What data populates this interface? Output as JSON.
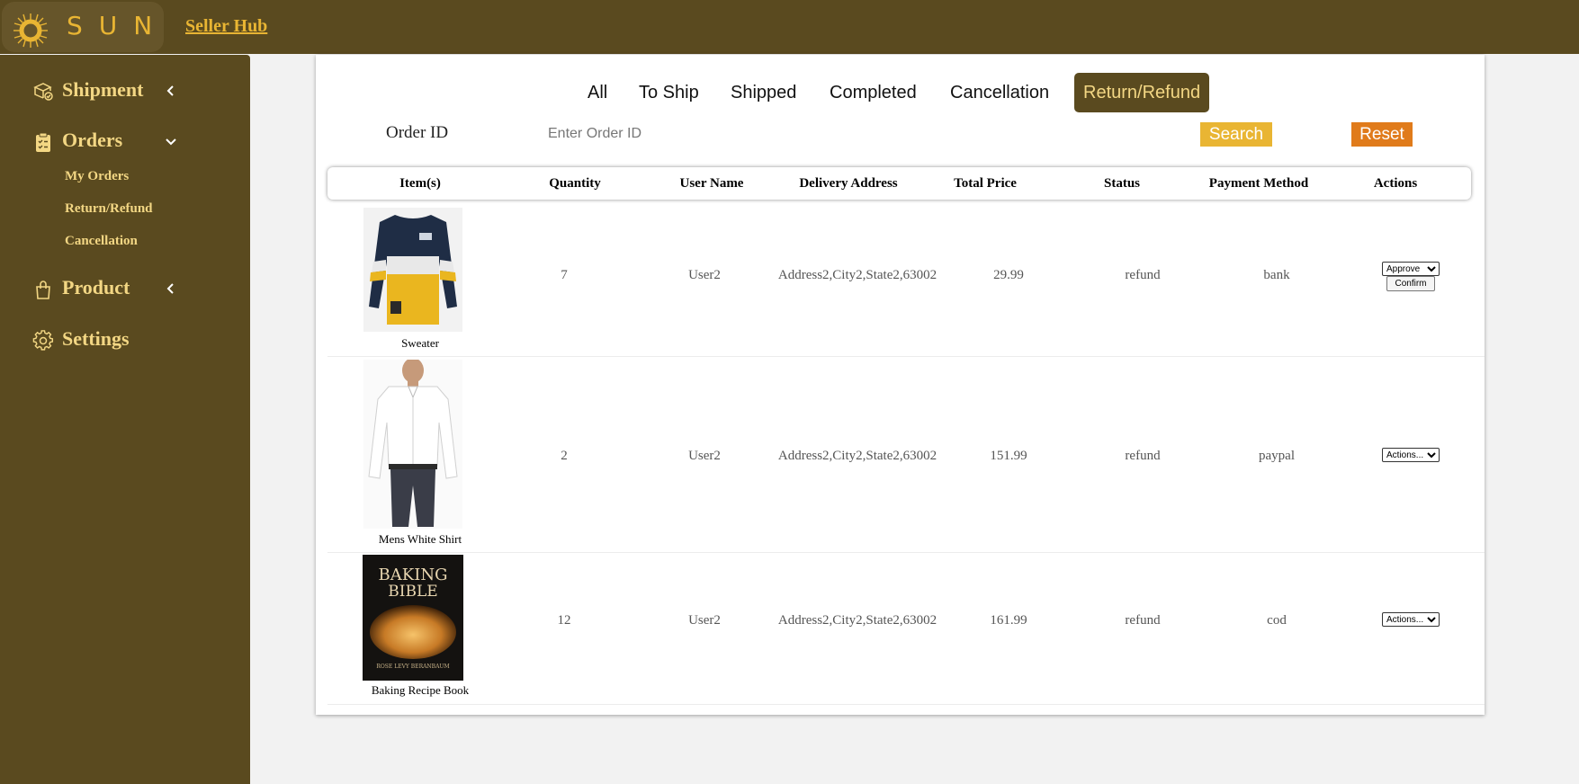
{
  "header": {
    "logo_text": "SUN",
    "seller_hub": "Seller Hub"
  },
  "sidebar": {
    "items": [
      {
        "label": "Shipment",
        "icon": "box-check-icon",
        "chevron": "chevron-left-icon"
      },
      {
        "label": "Orders",
        "icon": "clipboard-list-icon",
        "chevron": "chevron-down-icon"
      },
      {
        "label": "Product",
        "icon": "shopping-bag-icon",
        "chevron": "chevron-left-icon"
      },
      {
        "label": "Settings",
        "icon": "gear-icon"
      }
    ],
    "orders_sub": [
      "My Orders",
      "Return/Refund",
      "Cancellation"
    ]
  },
  "tabs": [
    "All",
    "To Ship",
    "Shipped",
    "Completed",
    "Cancellation",
    "Return/Refund"
  ],
  "active_tab": "Return/Refund",
  "search": {
    "label": "Order ID",
    "placeholder": "Enter Order ID",
    "search_button": "Search",
    "reset_button": "Reset"
  },
  "table": {
    "headers": [
      "Item(s)",
      "Quantity",
      "User Name",
      "Delivery Address",
      "Total Price",
      "Status",
      "Payment Method",
      "Actions"
    ],
    "rows": [
      {
        "item": "Sweater",
        "image": "sweater-image",
        "quantity": "7",
        "user": "User2",
        "address": "Address2,City2,State2,63002",
        "price": "29.99",
        "status": "refund",
        "payment": "bank",
        "action": "Approve",
        "confirm": "Confirm"
      },
      {
        "item": "Mens White Shirt",
        "image": "white-shirt-image",
        "quantity": "2",
        "user": "User2",
        "address": "Address2,City2,State2,63002",
        "price": "151.99",
        "status": "refund",
        "payment": "paypal",
        "action": "Actions..."
      },
      {
        "item": "Baking Recipe Book",
        "image": "baking-book-image",
        "quantity": "12",
        "user": "User2",
        "address": "Address2,City2,State2,63002",
        "price": "161.99",
        "status": "refund",
        "payment": "cod",
        "action": "Actions...",
        "book_title_1": "BAKING",
        "book_title_2": "BIBLE",
        "book_author": "ROSE LEVY BERANBAUM"
      }
    ]
  },
  "colors": {
    "brand_dark": "#5a4a1f",
    "brand_gold": "#e9b533",
    "sidebar_text": "#f3d784",
    "reset_orange": "#e07b1b"
  }
}
